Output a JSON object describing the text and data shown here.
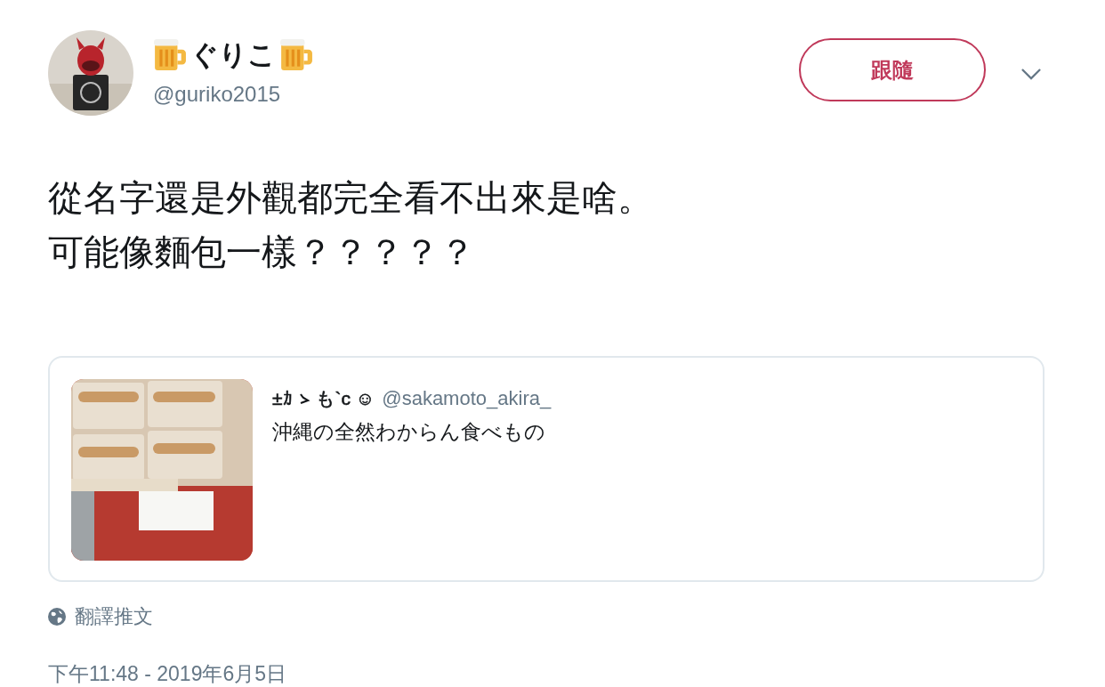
{
  "author": {
    "display_name": "ぐりこ",
    "handle": "@guriko2015"
  },
  "follow_button": {
    "label": "跟隨"
  },
  "tweet_text": [
    "從名字還是外觀都完全看不出來是啥。",
    "可能像麵包一樣？？？？？"
  ],
  "quoted_tweet": {
    "display_name_parts": [
      "±ｶ",
      "も`c ☺"
    ],
    "handle": "@sakamoto_akira_",
    "text": "沖縄の全然わからん食べもの"
  },
  "translate_link": "翻譯推文",
  "timestamp": "下午11:48 - 2019年6月5日"
}
